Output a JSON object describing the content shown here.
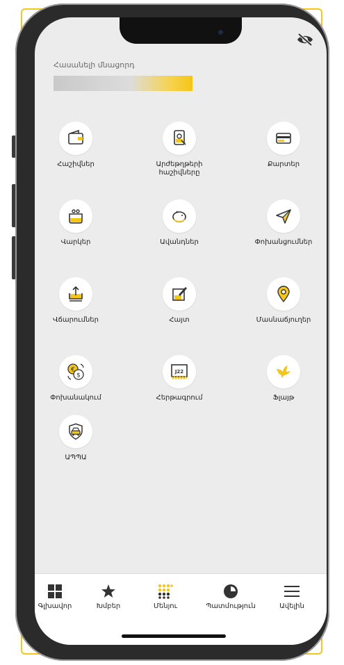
{
  "balance": {
    "label": "Հասանելի մնացորդ"
  },
  "menu": [
    {
      "label": "Հաշիվներ",
      "icon": "wallet-icon"
    },
    {
      "label": "Արժեթղթերի հաշիվները",
      "icon": "securities-icon"
    },
    {
      "label": "Քարտեր",
      "icon": "card-icon"
    },
    {
      "label": "Վարկեր",
      "icon": "purse-icon"
    },
    {
      "label": "Ավանդներ",
      "icon": "piggy-bank-icon"
    },
    {
      "label": "Փոխանցումներ",
      "icon": "send-icon"
    },
    {
      "label": "Վճարումներ",
      "icon": "upload-tray-icon"
    },
    {
      "label": "Հայտ",
      "icon": "edit-icon"
    },
    {
      "label": "Մասնաճյուղեր",
      "icon": "location-pin-icon"
    },
    {
      "label": "Փոխանակում",
      "icon": "currency-exchange-icon"
    },
    {
      "label": "Հերթագրում",
      "icon": "queue-ticket-icon"
    },
    {
      "label": "Ֆլայթ",
      "icon": "bird-icon"
    },
    {
      "label": "ԱՊՊԱ",
      "icon": "car-insurance-icon"
    }
  ],
  "tabs": [
    {
      "label": "Գլխավոր",
      "icon": "grid-icon"
    },
    {
      "label": "Խմբեր",
      "icon": "star-icon"
    },
    {
      "label": "Մենյու",
      "icon": "dots-grid-icon",
      "active": true
    },
    {
      "label": "Պատմություն",
      "icon": "clock-icon"
    },
    {
      "label": "Ավելին",
      "icon": "hamburger-icon"
    }
  ],
  "colors": {
    "accent": "#f5c518",
    "background": "#ececed",
    "icon_dark": "#333333"
  }
}
